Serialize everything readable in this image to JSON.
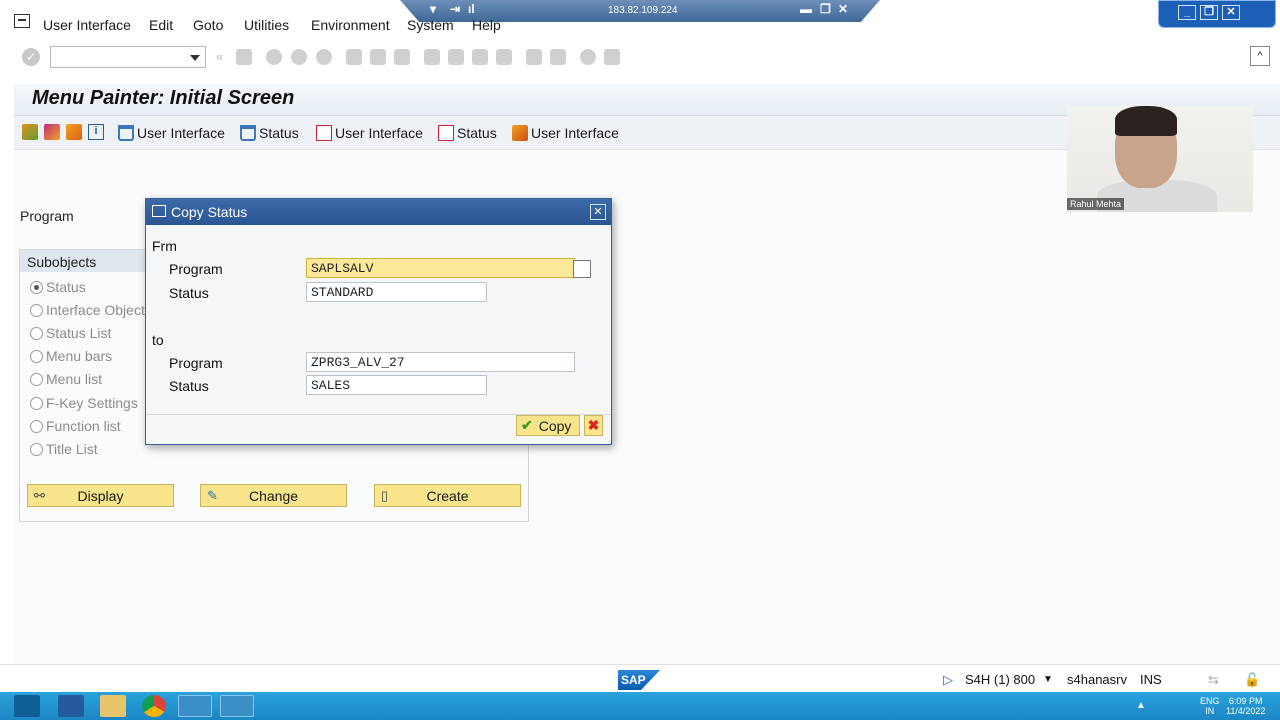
{
  "remote": {
    "ip": "183.82.109.224"
  },
  "menu": [
    "User Interface",
    "Edit",
    "Goto",
    "Utilities",
    "Environment",
    "System",
    "Help"
  ],
  "title": "Menu Painter: Initial Screen",
  "app_toolbar": {
    "b1": "User Interface",
    "b2": "Status",
    "b3": "User Interface",
    "b4": "Status",
    "b5": "User Interface"
  },
  "program_label": "Program",
  "subobjects": {
    "header": "Subobjects",
    "options": [
      "Status",
      "Interface Objects",
      "Status List",
      "Menu bars",
      "Menu list",
      "F-Key Settings",
      "Function list",
      "Title List"
    ],
    "selected": "Status"
  },
  "actions": {
    "display": "Display",
    "change": "Change",
    "create": "Create"
  },
  "dialog": {
    "title": "Copy Status",
    "from_label": "Frm",
    "to_label": "to",
    "program_label": "Program",
    "status_label": "Status",
    "from_program": "SAPLSALV",
    "from_status": "STANDARD",
    "to_program": "ZPRG3_ALV_27",
    "to_status": "SALES",
    "copy_label": "Copy"
  },
  "webcam": {
    "name": "Rahul Mehta"
  },
  "status_bar": {
    "system": "S4H (1) 800",
    "server": "s4hanasrv",
    "mode": "INS"
  },
  "taskbar": {
    "lang": "ENG",
    "region": "IN",
    "time": "6:09 PM",
    "date": "11/4/2022"
  },
  "colors": {
    "button_yellow": "#f8e48a",
    "dialog_title": "#2a5592",
    "taskbar": "#1b86c4"
  }
}
